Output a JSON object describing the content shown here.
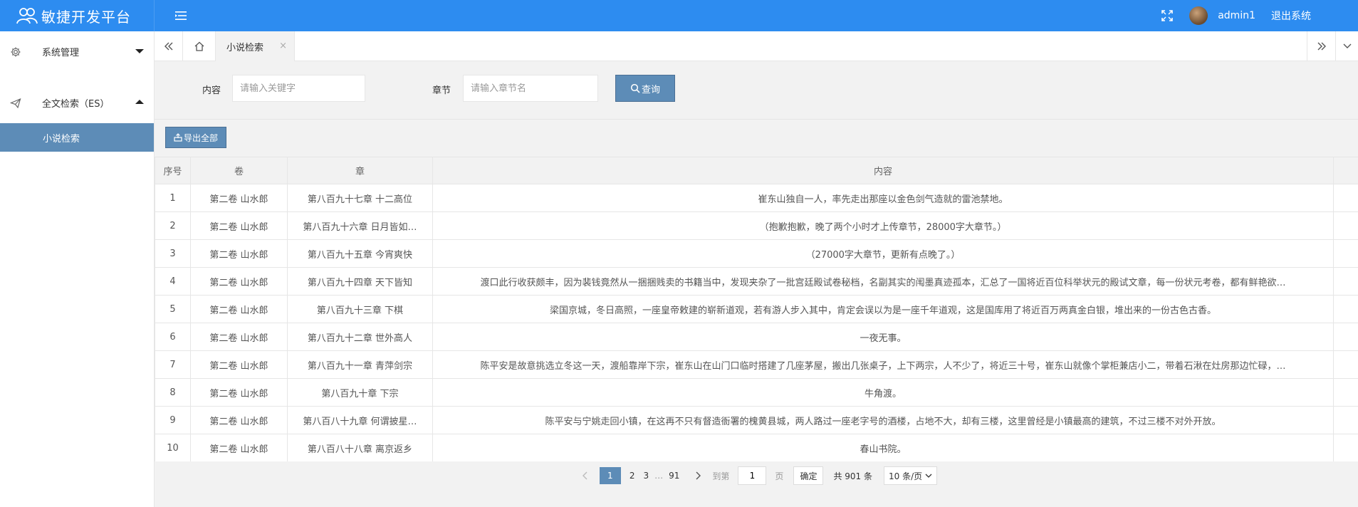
{
  "header": {
    "title": "敏捷开发平台",
    "username": "admin1",
    "logout": "退出系统"
  },
  "sidebar": {
    "groups": [
      {
        "label": "系统管理",
        "icon": "gear-icon",
        "expanded": false
      },
      {
        "label": "全文检索（ES）",
        "icon": "paper-plane-icon",
        "expanded": true
      }
    ],
    "active_item": "小说检索"
  },
  "tabs": {
    "active": "小说检索",
    "close": "×"
  },
  "search": {
    "content_label": "内容",
    "content_placeholder": "请输入关键字",
    "chapter_label": "章节",
    "chapter_placeholder": "请输入章节名",
    "query_label": "查询"
  },
  "toolbar": {
    "export_label": "导出全部"
  },
  "table": {
    "columns": [
      "序号",
      "卷",
      "章",
      "内容"
    ],
    "rows": [
      {
        "no": "1",
        "volume": "第二卷 山水郎",
        "chapter": "第八百九十七章 十二高位",
        "content": "崔东山独自一人，率先走出那座以金色剑气造就的雷池禁地。"
      },
      {
        "no": "2",
        "volume": "第二卷 山水郎",
        "chapter": "第八百九十六章 日月皆如…",
        "content": "（抱歉抱歉，晚了两个小时才上传章节，28000字大章节。）"
      },
      {
        "no": "3",
        "volume": "第二卷 山水郎",
        "chapter": "第八百九十五章 今宵爽快",
        "content": "（27000字大章节，更新有点晚了。）"
      },
      {
        "no": "4",
        "volume": "第二卷 山水郎",
        "chapter": "第八百九十四章 天下皆知",
        "content": "渡口此行收获颇丰，因为裴钱竟然从一捆捆贱卖的书籍当中，发现夹杂了一批宫廷殿试卷秘档，名副其实的闱墨真迹孤本，汇总了一国将近百位科举状元的殿试文章，每一份状元考卷，都有鲜艳欲…"
      },
      {
        "no": "5",
        "volume": "第二卷 山水郎",
        "chapter": "第八百九十三章 下棋",
        "content": "梁国京城，冬日高照，一座皇帝敕建的崭新道观，若有游人步入其中，肯定会误以为是一座千年道观，这是国库用了将近百万两真金白银，堆出来的一份古色古香。"
      },
      {
        "no": "6",
        "volume": "第二卷 山水郎",
        "chapter": "第八百九十二章 世外高人",
        "content": "一夜无事。"
      },
      {
        "no": "7",
        "volume": "第二卷 山水郎",
        "chapter": "第八百九十一章 青萍剑宗",
        "content": "陈平安是故意挑选立冬这一天，渡船靠岸下宗，崔东山在山门口临时搭建了几座茅屋，搬出几张桌子，上下两宗，人不少了，将近三十号，崔东山就像个掌柜兼店小二，带着石湫在灶房那边忙碌，…"
      },
      {
        "no": "8",
        "volume": "第二卷 山水郎",
        "chapter": "第八百九十章 下宗",
        "content": "牛角渡。"
      },
      {
        "no": "9",
        "volume": "第二卷 山水郎",
        "chapter": "第八百八十九章 何谓披星…",
        "content": "陈平安与宁姚走回小镇，在这再不只有督造衙署的槐黄县城，两人路过一座老字号的酒楼，占地不大，却有三楼，这里曾经是小镇最高的建筑，不过三楼不对外开放。"
      },
      {
        "no": "10",
        "volume": "第二卷 山水郎",
        "chapter": "第八百八十八章 离京返乡",
        "content": "春山书院。"
      }
    ]
  },
  "pager": {
    "pages": [
      "1",
      "2",
      "3"
    ],
    "ellipsis": "…",
    "last": "91",
    "goto_label": "到第",
    "goto_value": "1",
    "page_unit": "页",
    "confirm": "确定",
    "total": "共 901 条",
    "page_size": "10 条/页"
  }
}
